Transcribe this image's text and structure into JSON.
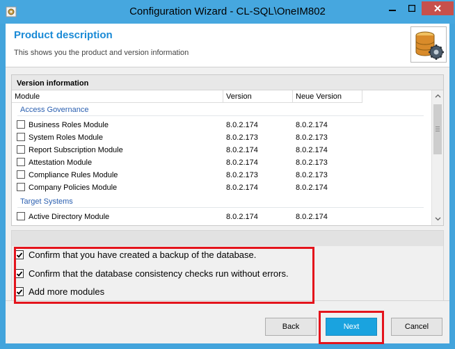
{
  "window": {
    "title": "Configuration Wizard - CL-SQL\\OneIM802"
  },
  "header": {
    "title": "Product description",
    "subtitle": "This shows you the product and version information",
    "logo_icon": "database-gear-icon"
  },
  "version_panel": {
    "title": "Version information",
    "columns": [
      "Module",
      "Version",
      "Neue Version"
    ],
    "groups": [
      {
        "name": "Access Governance",
        "rows": [
          {
            "module": "Business Roles Module",
            "version": "8.0.2.174",
            "new_version": "8.0.2.174",
            "checked": false
          },
          {
            "module": "System Roles Module",
            "version": "8.0.2.173",
            "new_version": "8.0.2.173",
            "checked": false
          },
          {
            "module": "Report Subscription Module",
            "version": "8.0.2.174",
            "new_version": "8.0.2.174",
            "checked": false
          },
          {
            "module": "Attestation Module",
            "version": "8.0.2.174",
            "new_version": "8.0.2.173",
            "checked": false
          },
          {
            "module": "Compliance Rules Module",
            "version": "8.0.2.173",
            "new_version": "8.0.2.173",
            "checked": false
          },
          {
            "module": "Company Policies Module",
            "version": "8.0.2.174",
            "new_version": "8.0.2.174",
            "checked": false
          }
        ]
      },
      {
        "name": "Target Systems",
        "rows": [
          {
            "module": "Active Directory Module",
            "version": "8.0.2.174",
            "new_version": "8.0.2.174",
            "checked": false
          }
        ]
      }
    ]
  },
  "confirmations": [
    {
      "label": "Confirm that you have created a backup of the database.",
      "checked": true
    },
    {
      "label": "Confirm that the database consistency checks run without errors.",
      "checked": true
    },
    {
      "label": "Add more modules",
      "checked": true
    }
  ],
  "footer": {
    "back_label": "Back",
    "next_label": "Next",
    "cancel_label": "Cancel"
  },
  "colors": {
    "title_bar": "#46a7df",
    "accent": "#1aa3df",
    "highlight": "#e4141c",
    "close_button": "#c7504c"
  }
}
